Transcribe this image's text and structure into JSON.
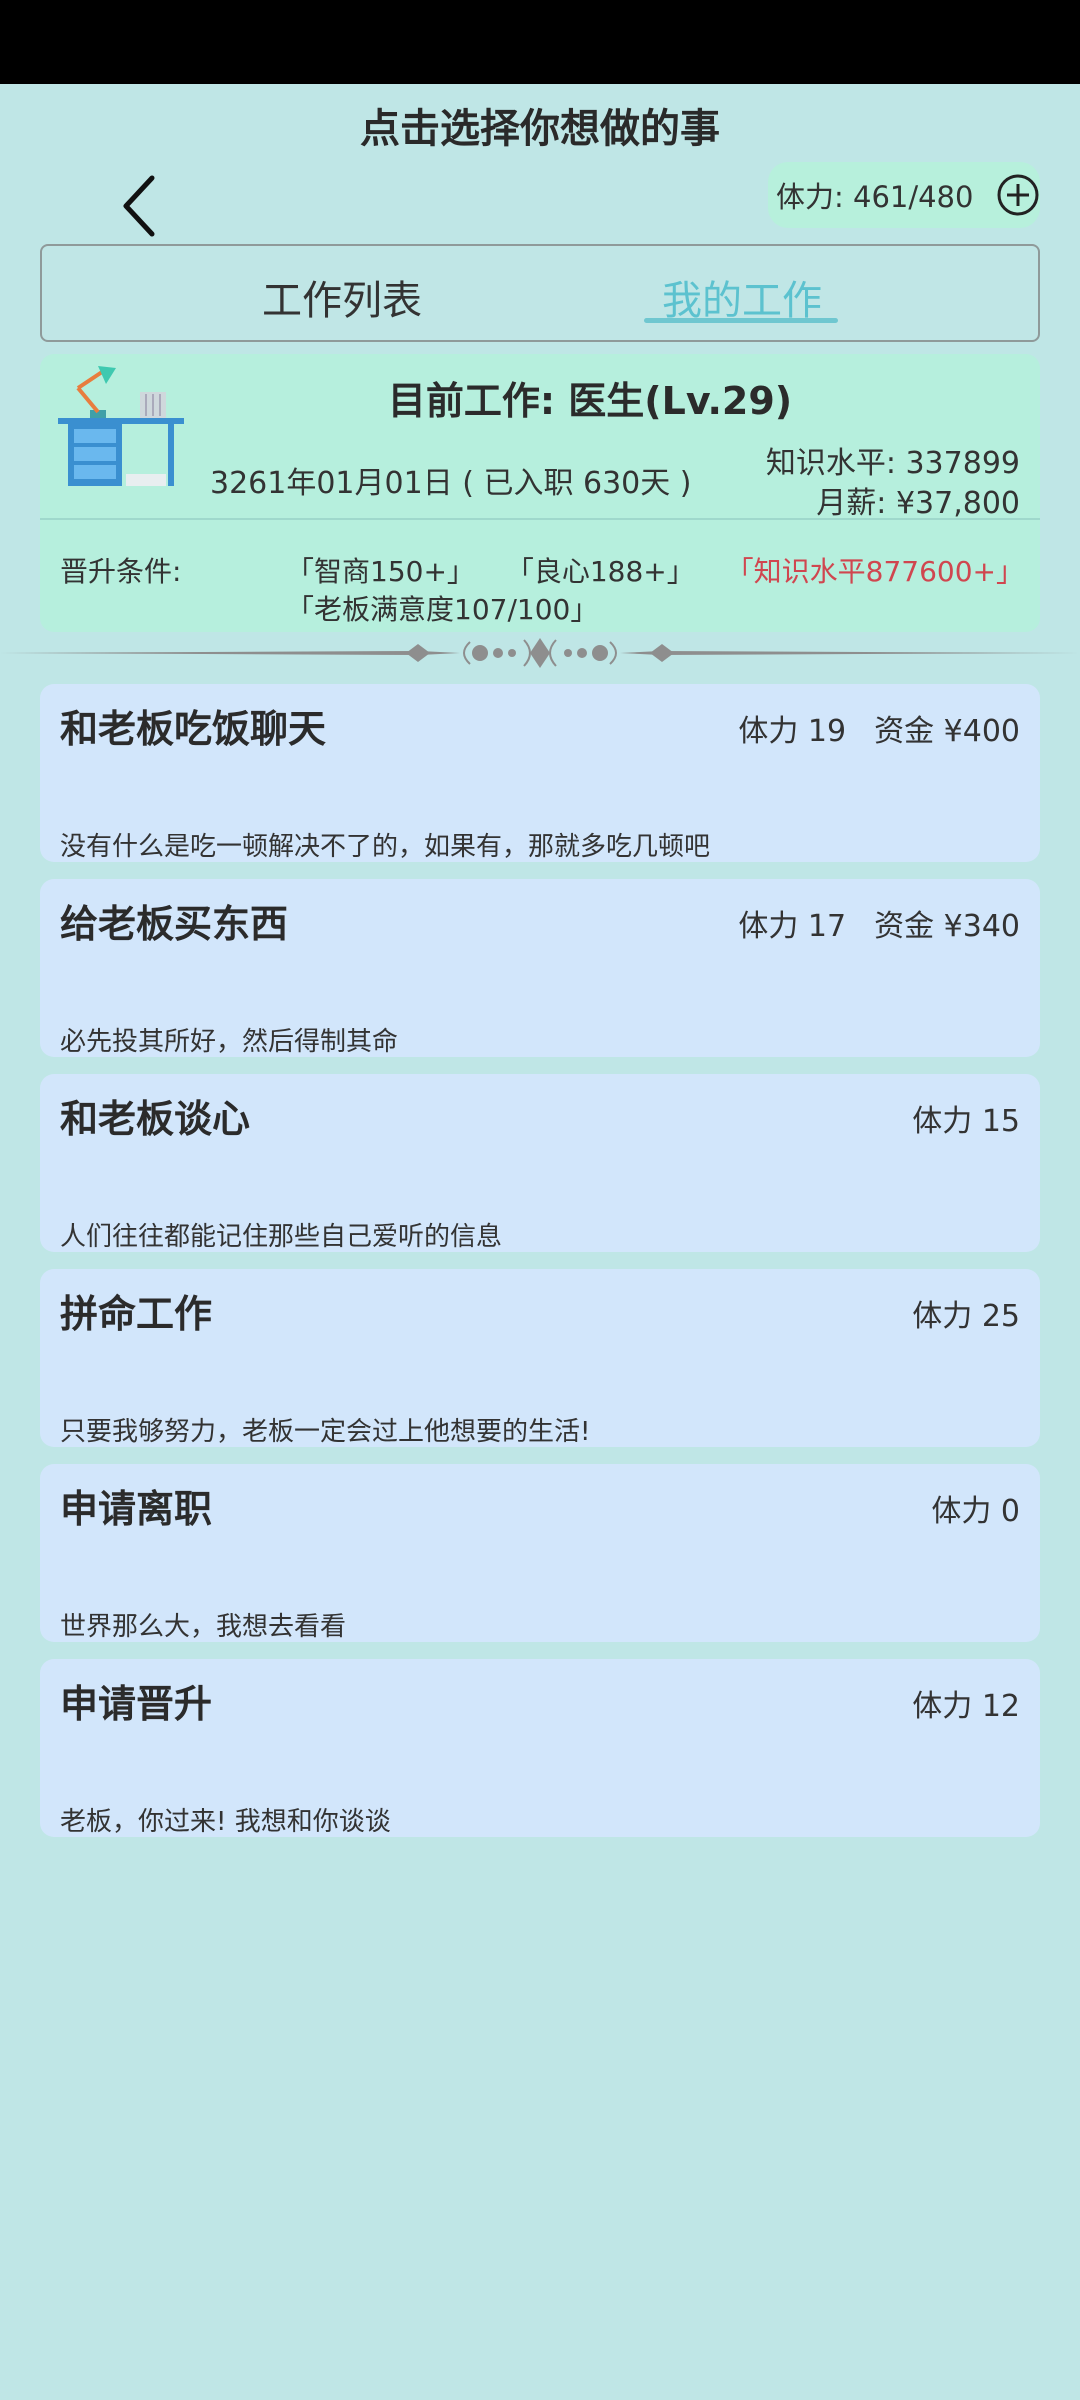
{
  "header": {
    "title": "点击选择你想做的事",
    "stamina_label": "体力: 461/480"
  },
  "tabs": [
    {
      "label": "工作列表",
      "active": false
    },
    {
      "label": "我的工作",
      "active": true
    }
  ],
  "current_job": {
    "title": "目前工作: 医生(Lv.29)",
    "date": "3261年01月01日 ( 已入职 630天 )",
    "knowledge": "知识水平: 337899",
    "salary": "月薪: ¥37,800",
    "promotion_label": "晋升条件:",
    "conditions": [
      {
        "text": "「智商150+」",
        "met": true
      },
      {
        "text": "「良心188+」",
        "met": true
      },
      {
        "text": "「知识水平877600+」",
        "met": false
      },
      {
        "text": "「老板满意度107/100」",
        "met": true
      }
    ]
  },
  "actions": [
    {
      "title": "和老板吃饭聊天",
      "stamina": "体力 19",
      "money": "资金 ¥400",
      "desc": "没有什么是吃一顿解决不了的，如果有，那就多吃几顿吧"
    },
    {
      "title": "给老板买东西",
      "stamina": "体力 17",
      "money": "资金 ¥340",
      "desc": "必先投其所好，然后得制其命"
    },
    {
      "title": "和老板谈心",
      "stamina": "体力 15",
      "money": "",
      "desc": "人们往往都能记住那些自己爱听的信息"
    },
    {
      "title": "拼命工作",
      "stamina": "体力 25",
      "money": "",
      "desc": "只要我够努力，老板一定会过上他想要的生活!"
    },
    {
      "title": "申请离职",
      "stamina": "体力 0",
      "money": "",
      "desc": "世界那么大，我想去看看"
    },
    {
      "title": "申请晋升",
      "stamina": "体力 12",
      "money": "",
      "desc": "老板，你过来! 我想和你谈谈"
    }
  ],
  "colors": {
    "background": "#bfe6e6",
    "job_card": "#b6efdd",
    "action_card": "#d2e6fb",
    "active_tab": "#5cc2cf",
    "unmet_condition": "#d0464f"
  }
}
